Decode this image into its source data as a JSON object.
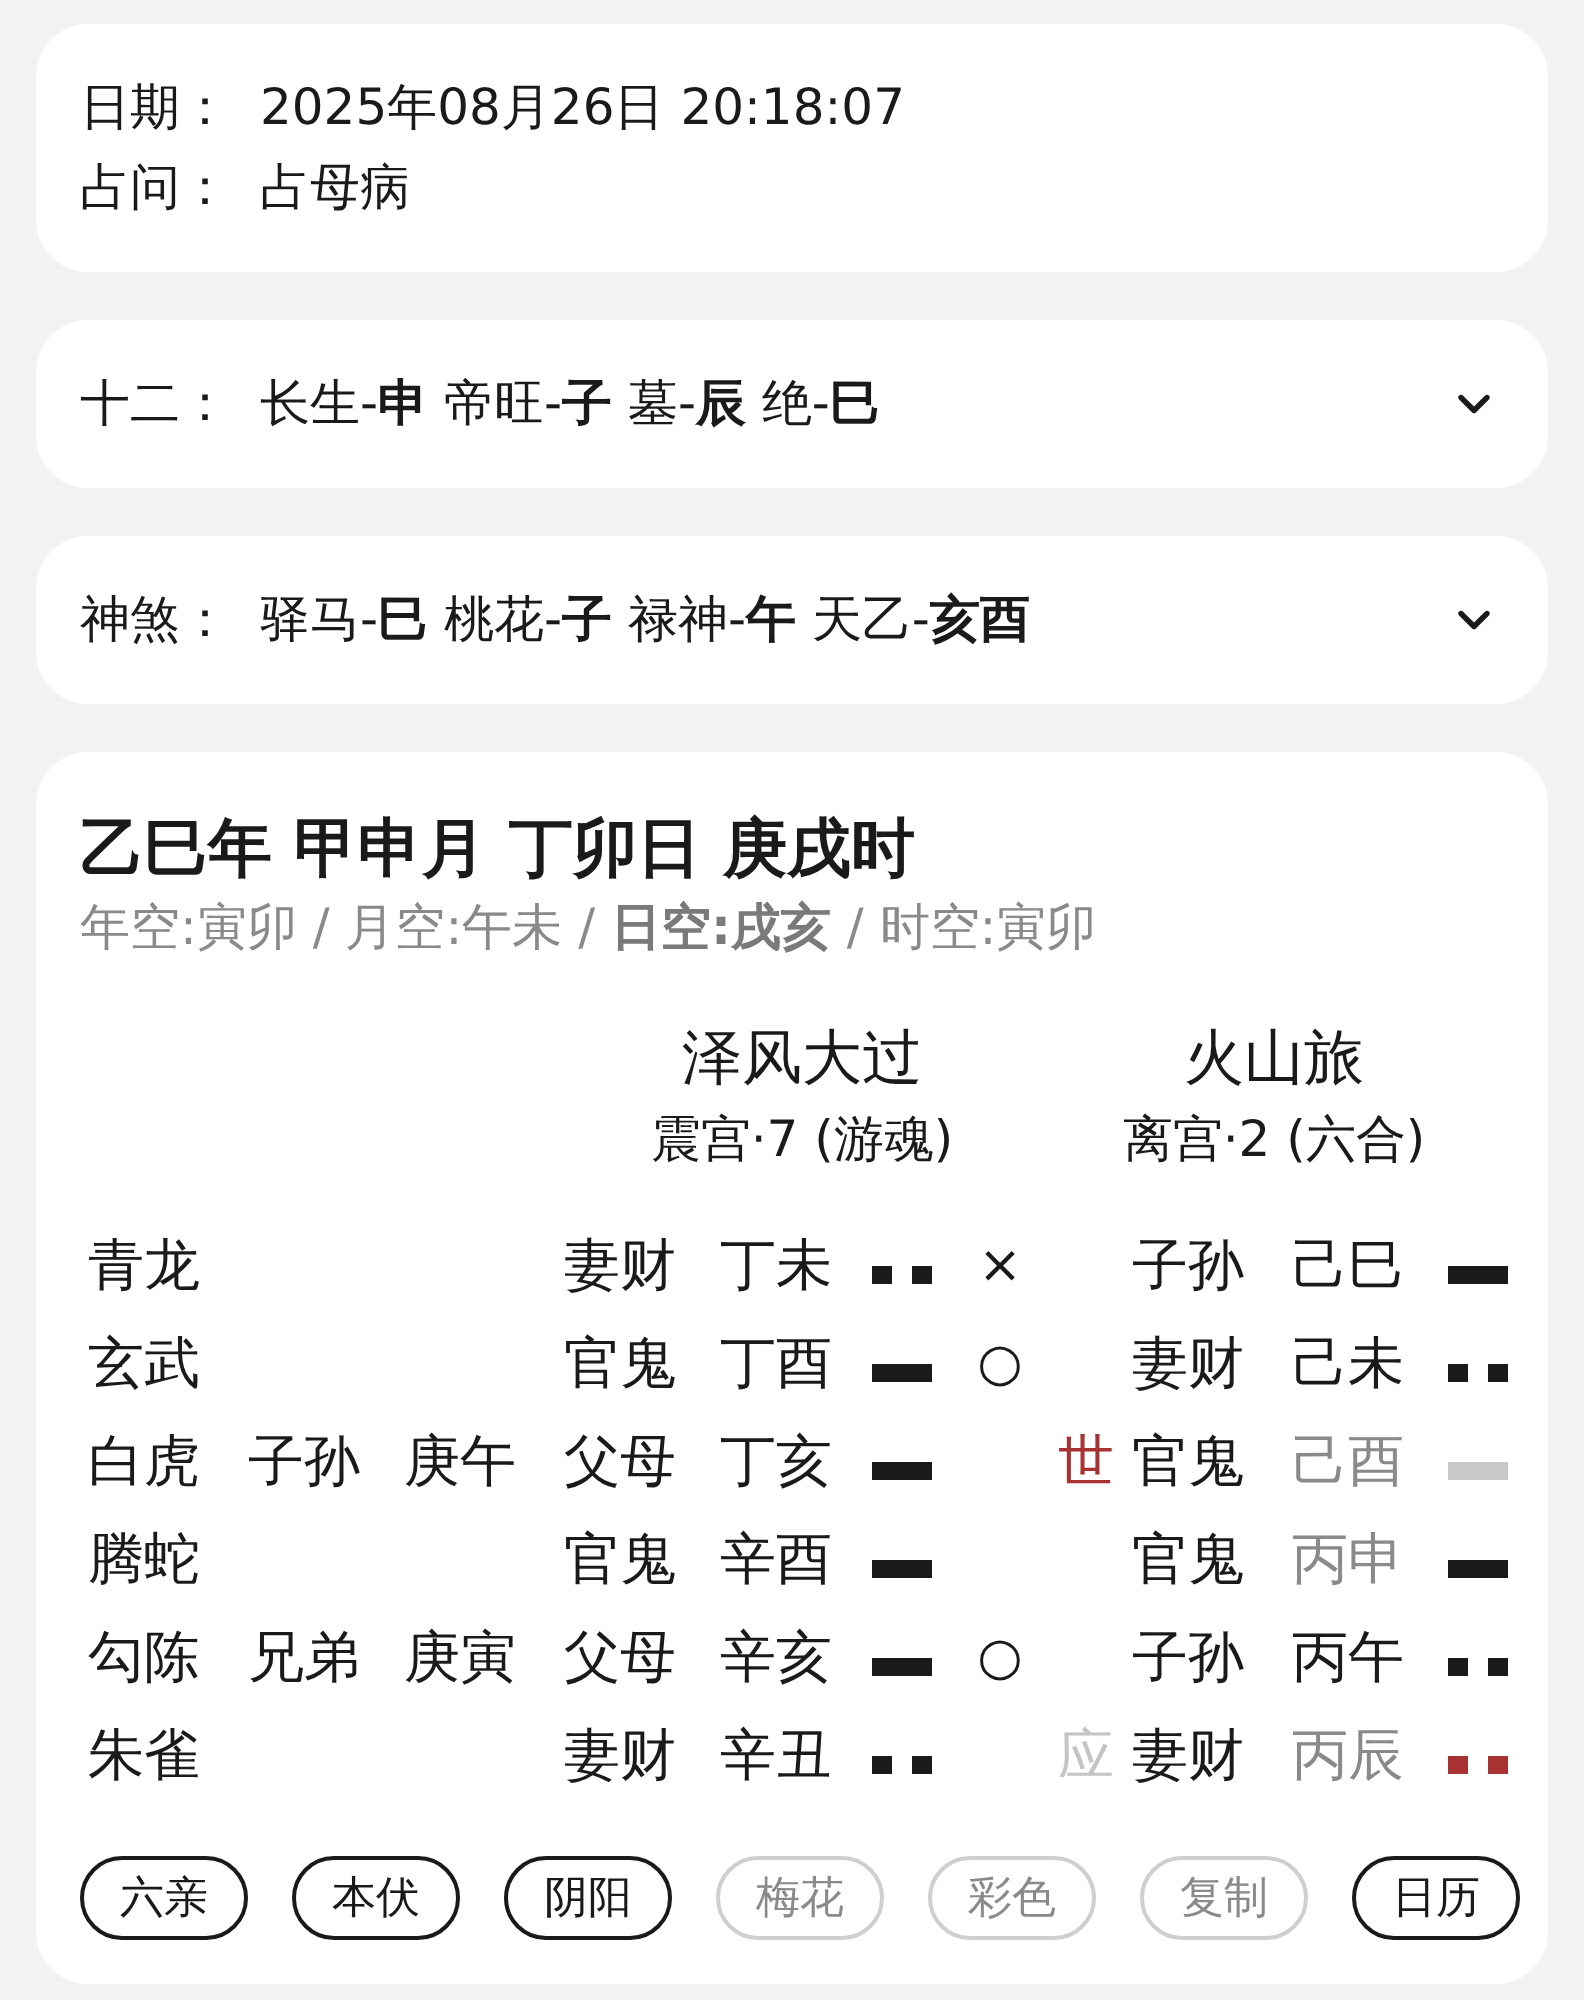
{
  "info": {
    "fields": [
      {
        "label": "日期：",
        "value": "2025年08月26日 20:18:07"
      },
      {
        "label": "占问：",
        "value": "占母病"
      }
    ]
  },
  "panels": [
    {
      "label": "十二：",
      "text": "长生-**申** 帝旺-**子** 墓-**辰** 绝-**巳**",
      "expanded": false
    },
    {
      "label": "神煞：",
      "text": "驿马-**巳** 桃花-**子** 禄神-**午** 天乙-**亥酉**",
      "expanded": false
    }
  ],
  "chart": {
    "title": "乙巳年 甲申月 丁卯日 庚戌时",
    "voids": "年空:寅卯 / 月空:午未 / **日空:戌亥** / 时空:寅卯",
    "main_hexagram": {
      "name": "泽风大过",
      "palace": "震宫·7 (游魂)"
    },
    "changed_hexagram": {
      "name": "火山旅",
      "palace": "离宫·2 (六合)"
    },
    "rows": [
      {
        "spirit": "青龙",
        "main_relative": "妻财",
        "main_branch": "丁未",
        "main_line": {
          "kind": "yin"
        },
        "moving": "×",
        "changed_relative": "子孙",
        "changed_branch": "己巳",
        "changed_muted": false,
        "changed_line": {
          "kind": "yang",
          "color": "#1a1a1a"
        }
      },
      {
        "spirit": "玄武",
        "main_relative": "官鬼",
        "main_branch": "丁酉",
        "main_line": {
          "kind": "yang"
        },
        "moving": "○",
        "changed_relative": "妻财",
        "changed_branch": "己未",
        "changed_muted": false,
        "changed_line": {
          "kind": "yin",
          "color": "#1a1a1a"
        }
      },
      {
        "spirit": "白虎",
        "hidden_relative": "子孙",
        "hidden_branch": "庚午",
        "main_relative": "父母",
        "main_branch": "丁亥",
        "main_line": {
          "kind": "yang"
        },
        "mark": {
          "kind": "shi",
          "text": "世"
        },
        "changed_relative": "官鬼",
        "changed_branch": "己酉",
        "changed_muted": true,
        "changed_line": {
          "kind": "yang",
          "color": "#c8c8c8"
        }
      },
      {
        "spirit": "腾蛇",
        "main_relative": "官鬼",
        "main_branch": "辛酉",
        "main_line": {
          "kind": "yang"
        },
        "changed_relative": "官鬼",
        "changed_branch": "丙申",
        "changed_muted": true,
        "changed_line": {
          "kind": "yang",
          "color": "#1a1a1a"
        }
      },
      {
        "spirit": "勾陈",
        "hidden_relative": "兄弟",
        "hidden_branch": "庚寅",
        "main_relative": "父母",
        "main_branch": "辛亥",
        "main_line": {
          "kind": "yang"
        },
        "moving": "○",
        "changed_relative": "子孙",
        "changed_branch": "丙午",
        "changed_muted": false,
        "changed_line": {
          "kind": "yin",
          "color": "#1a1a1a"
        }
      },
      {
        "spirit": "朱雀",
        "main_relative": "妻财",
        "main_branch": "辛丑",
        "main_line": {
          "kind": "yin"
        },
        "mark": {
          "kind": "ying",
          "text": "应"
        },
        "changed_relative": "妻财",
        "changed_branch": "丙辰",
        "changed_muted": true,
        "changed_line": {
          "kind": "yin",
          "color": "#a83232"
        }
      }
    ],
    "toggles": [
      {
        "label": "六亲",
        "on": true
      },
      {
        "label": "本伏",
        "on": true
      },
      {
        "label": "阴阳",
        "on": true
      },
      {
        "label": "梅花",
        "on": false
      },
      {
        "label": "彩色",
        "on": false
      },
      {
        "label": "复制",
        "on": false
      },
      {
        "label": "日历",
        "on": true
      }
    ]
  }
}
